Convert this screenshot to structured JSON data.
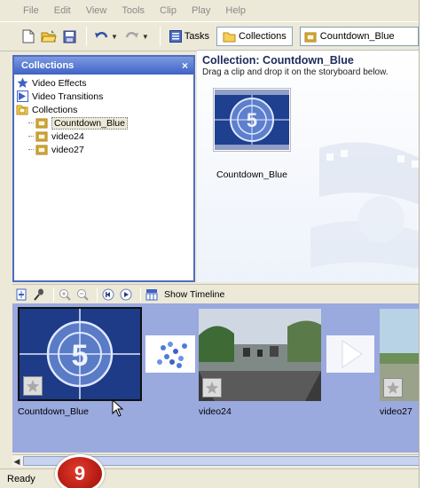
{
  "menu": [
    "File",
    "Edit",
    "View",
    "Tools",
    "Clip",
    "Play",
    "Help"
  ],
  "toolbar": {
    "tasks_label": "Tasks",
    "collections_label": "Collections",
    "collection_combo_value": "Countdown_Blue"
  },
  "collections_pane": {
    "title": "Collections",
    "close_glyph": "×",
    "items": [
      {
        "label": "Video Effects",
        "icon": "star-effects-icon"
      },
      {
        "label": "Video Transitions",
        "icon": "transitions-icon"
      },
      {
        "label": "Collections",
        "icon": "collections-folder-icon"
      }
    ],
    "children": [
      {
        "label": "Countdown_Blue",
        "selected": true
      },
      {
        "label": "video24",
        "selected": false
      },
      {
        "label": "video27",
        "selected": false
      }
    ]
  },
  "collection_view": {
    "title": "Collection: Countdown_Blue",
    "hint": "Drag a clip and drop it on the storyboard below.",
    "clip_label": "Countdown_Blue"
  },
  "storyboard_toolbar": {
    "show_timeline_label": "Show Timeline"
  },
  "storyboard": {
    "clips": [
      {
        "label": "Countdown_Blue",
        "countdown_number": "5"
      },
      {
        "label": "video24"
      },
      {
        "label": "video27"
      }
    ]
  },
  "status": {
    "text": "Ready"
  },
  "badge": {
    "number": "9"
  },
  "colors": {
    "pane_header": "#3f62c6",
    "storyboard_bg": "#9aa9de",
    "badge_red": "#c9241a"
  }
}
